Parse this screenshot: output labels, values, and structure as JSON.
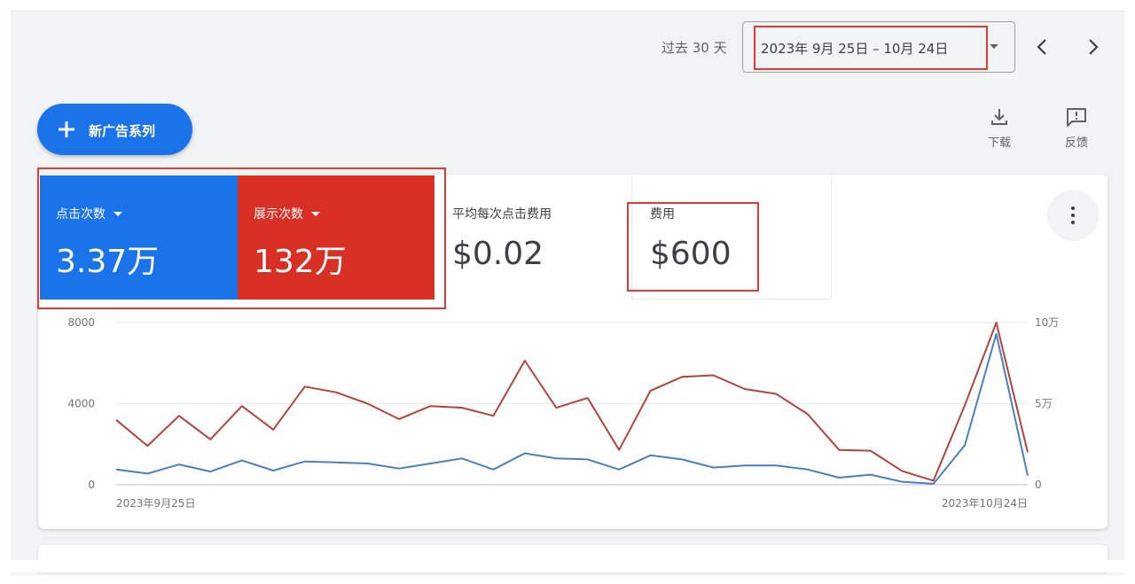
{
  "header": {
    "range_label": "过去 30 天",
    "date_range": "2023年 9月 25日 – 10月 24日"
  },
  "toolbar": {
    "new_campaign_label": "新广告系列",
    "download_label": "下载",
    "feedback_label": "反馈"
  },
  "metrics": {
    "clicks": {
      "label": "点击次数",
      "value": "3.37万",
      "color": "#1a73e8"
    },
    "impressions": {
      "label": "展示次数",
      "value": "132万",
      "color": "#d93025"
    },
    "avg_cpc": {
      "label": "平均每次点击费用",
      "value": "$0.02"
    },
    "cost": {
      "label": "费用",
      "value": "$600"
    }
  },
  "colors": {
    "highlight": "#e53935",
    "clicks_line": "#4a7fc1",
    "impressions_line": "#b4443b"
  },
  "chart_data": {
    "type": "line",
    "x_start_label": "2023年9月25日",
    "x_end_label": "2023年10月24日",
    "left_axis": {
      "ticks": [
        "8000",
        "4000",
        "0"
      ],
      "range": [
        0,
        8000
      ]
    },
    "right_axis": {
      "ticks": [
        "10万",
        "5万",
        "0"
      ],
      "range": [
        0,
        100000
      ]
    },
    "x": [
      "2023-09-25",
      "2023-09-26",
      "2023-09-27",
      "2023-09-28",
      "2023-09-29",
      "2023-09-30",
      "2023-10-01",
      "2023-10-02",
      "2023-10-03",
      "2023-10-04",
      "2023-10-05",
      "2023-10-06",
      "2023-10-07",
      "2023-10-08",
      "2023-10-09",
      "2023-10-10",
      "2023-10-11",
      "2023-10-12",
      "2023-10-13",
      "2023-10-14",
      "2023-10-15",
      "2023-10-16",
      "2023-10-17",
      "2023-10-18",
      "2023-10-19",
      "2023-10-20",
      "2023-10-21",
      "2023-10-22",
      "2023-10-23",
      "2023-10-24"
    ],
    "series": [
      {
        "name": "点击次数",
        "axis": "left",
        "values": [
          750,
          550,
          1000,
          650,
          1200,
          700,
          1150,
          1100,
          1050,
          800,
          1050,
          1300,
          750,
          1550,
          1300,
          1250,
          750,
          1450,
          1250,
          850,
          950,
          950,
          750,
          350,
          500,
          150,
          50,
          1950,
          7450,
          450
        ]
      },
      {
        "name": "展示次数",
        "axis": "right",
        "values": [
          40000,
          24000,
          42500,
          28000,
          48500,
          34000,
          60500,
          57000,
          50000,
          40500,
          48500,
          47500,
          42500,
          76500,
          47500,
          53500,
          21500,
          58000,
          66500,
          67500,
          59000,
          56000,
          43500,
          21500,
          21000,
          8500,
          2500,
          49000,
          100000,
          20000
        ]
      }
    ]
  }
}
